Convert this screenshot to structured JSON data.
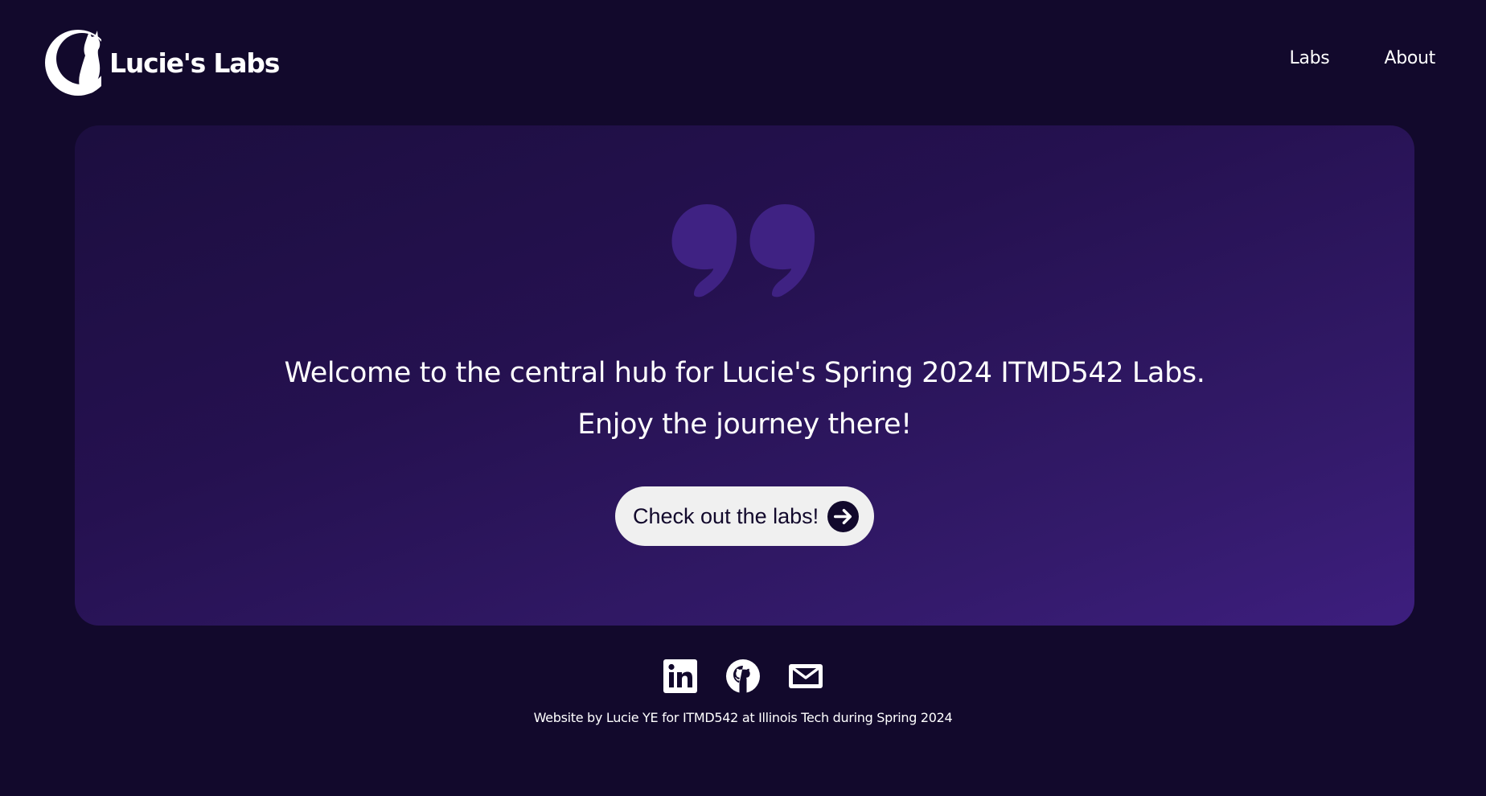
{
  "header": {
    "logo_text": "Lucie's Labs",
    "logo_icon": "cat-moon-logo",
    "nav": [
      {
        "label": "Labs"
      },
      {
        "label": "About"
      }
    ]
  },
  "hero": {
    "quote_icon": "quote-mark-icon",
    "welcome_line1": "Welcome to the central hub for Lucie's Spring 2024 ITMD542 Labs.",
    "welcome_line2": "Enjoy the journey there!",
    "cta_label": "Check out the labs!",
    "cta_icon": "arrow-right-circle-icon"
  },
  "footer": {
    "socials": [
      {
        "name": "linkedin-icon"
      },
      {
        "name": "github-icon"
      },
      {
        "name": "mail-icon"
      }
    ],
    "credit": "Website by Lucie YE for ITMD542 at Illinois Tech during Spring 2024"
  },
  "colors": {
    "background": "#12092c",
    "hero_start": "#1c0e3f",
    "hero_end": "#3d1e7e",
    "quote": "#3f2283",
    "button_bg": "#f0f0f0",
    "text": "#ffffff"
  }
}
